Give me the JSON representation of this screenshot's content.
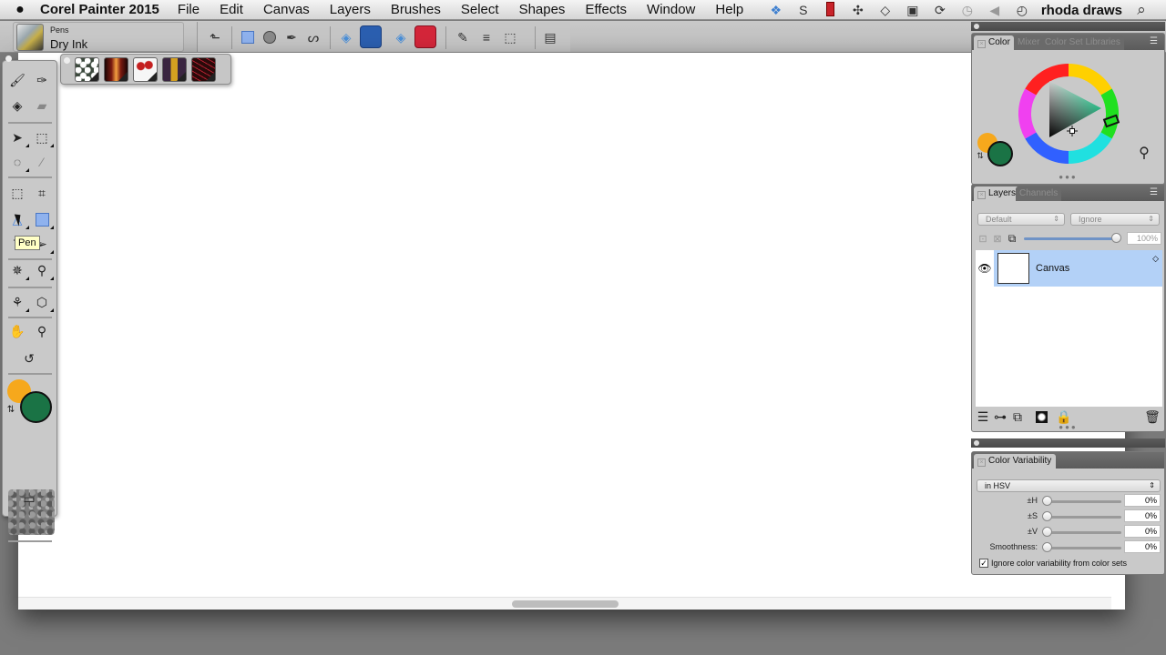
{
  "menubar": {
    "apple": "",
    "app_name": "Corel Painter 2015",
    "menus": [
      "File",
      "Edit",
      "Canvas",
      "Layers",
      "Brushes",
      "Select",
      "Shapes",
      "Effects",
      "Window",
      "Help"
    ],
    "status_icons": [
      "dropbox-icon",
      "skype-icon",
      "recording-icon",
      "bluetooth-icon",
      "wifi-icon",
      "display-icon",
      "sync-icon",
      "time-machine-icon",
      "volume-icon",
      "clock-icon"
    ],
    "user": "rhoda draws",
    "search_icon": "⌕"
  },
  "property_bar": {
    "brush_category": "Pens",
    "brush_variant": "Dry Ink",
    "tools": [
      "reset-tool-icon",
      "rectangle-shape-icon",
      "ellipse-shape-icon",
      "pen-shape-icon",
      "freehand-shape-icon",
      "stroke-paint-icon",
      "stroke-color-swatch",
      "fill-paint-icon",
      "fill-color-swatch",
      "pen-options-icon",
      "layer-convert-icon",
      "selection-convert-icon",
      "panel-toggle-icon"
    ],
    "stroke_color": "#2b5fb0",
    "fill_color": "#d4263a"
  },
  "brush_library": {
    "thumbs": [
      "floral-pattern",
      "orange-gradient",
      "red-flowers",
      "plaid-pattern",
      "red-lines"
    ]
  },
  "toolbox": {
    "tooltip": "Pen",
    "main_color": "#1a7345",
    "additional_color": "#f6a81c",
    "tools": [
      "brush",
      "dropper",
      "paint-bucket",
      "eraser",
      "layer-adjuster",
      "rectangular-selection",
      "lasso",
      "magic-wand",
      "transform",
      "crop",
      "pen",
      "rectangle",
      "text",
      "shape-selection",
      "cloner",
      "rubber-stamp",
      "dodge",
      "perspective",
      "grabber",
      "magnifier",
      "rotate-page"
    ]
  },
  "color_panel": {
    "tabs": [
      "Color",
      "Mixer",
      "Color Set Libraries"
    ],
    "active_tab": "Color",
    "main_color": "#1a7345",
    "additional_color": "#f6a81c"
  },
  "layers_panel": {
    "tabs": [
      "Layers",
      "Channels"
    ],
    "active_tab": "Layers",
    "composite_method": "Default",
    "composite_depth": "Ignore",
    "opacity_value": "100%",
    "opacity_fraction": 1.0,
    "layers": [
      {
        "name": "Canvas",
        "visible": true,
        "selected": true
      }
    ]
  },
  "color_variability_panel": {
    "title": "Color Variability",
    "mode": "in HSV",
    "sliders": [
      {
        "label": "±H",
        "value": "0%"
      },
      {
        "label": "±S",
        "value": "0%"
      },
      {
        "label": "±V",
        "value": "0%"
      },
      {
        "label": "Smoothness:",
        "value": "0%"
      }
    ],
    "checkbox_label": "Ignore color variability from color sets",
    "checkbox_checked": true
  }
}
